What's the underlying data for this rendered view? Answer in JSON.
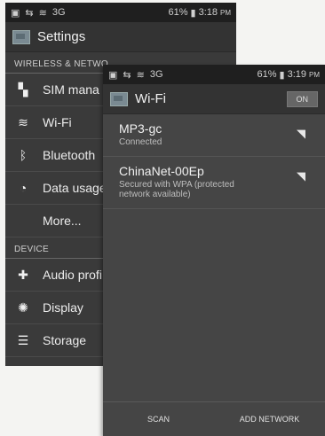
{
  "status_back": {
    "battery": "61%",
    "time": "3:18",
    "ampm": "PM",
    "network": "3G"
  },
  "status_front": {
    "battery": "61%",
    "time": "3:19",
    "ampm": "PM",
    "network": "3G"
  },
  "settings": {
    "title": "Settings",
    "section_wireless": "WIRELESS & NETWO",
    "items": [
      {
        "label": "SIM mana",
        "icon": "sim-icon"
      },
      {
        "label": "Wi-Fi",
        "icon": "wifi-icon"
      },
      {
        "label": "Bluetooth",
        "icon": "bluetooth-icon"
      },
      {
        "label": "Data usage",
        "icon": "data-usage-icon"
      },
      {
        "label": "More..."
      }
    ],
    "section_device": "DEVICE",
    "device_items": [
      {
        "label": "Audio profi",
        "icon": "audio-profile-icon"
      },
      {
        "label": "Display",
        "icon": "display-icon"
      },
      {
        "label": "Storage",
        "icon": "storage-icon"
      }
    ]
  },
  "wifi": {
    "title": "Wi-Fi",
    "toggle": "ON",
    "networks": [
      {
        "name": "MP3-gc",
        "status": "Connected",
        "icon": "wifi-signal-icon"
      },
      {
        "name": "ChinaNet-00Ep",
        "status": "Secured with WPA (protected network available)",
        "icon": "wifi-signal-icon"
      }
    ],
    "scan_label": "SCAN",
    "add_network_label": "ADD NETWORK"
  }
}
